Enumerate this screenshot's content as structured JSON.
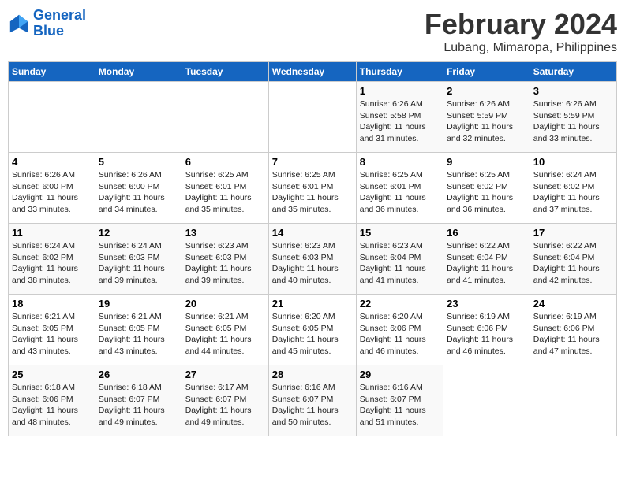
{
  "logo": {
    "line1": "General",
    "line2": "Blue"
  },
  "title": "February 2024",
  "subtitle": "Lubang, Mimaropa, Philippines",
  "days_of_week": [
    "Sunday",
    "Monday",
    "Tuesday",
    "Wednesday",
    "Thursday",
    "Friday",
    "Saturday"
  ],
  "weeks": [
    [
      {
        "day": "",
        "info": ""
      },
      {
        "day": "",
        "info": ""
      },
      {
        "day": "",
        "info": ""
      },
      {
        "day": "",
        "info": ""
      },
      {
        "day": "1",
        "sunrise": "6:26 AM",
        "sunset": "5:58 PM",
        "daylight": "11 hours and 31 minutes."
      },
      {
        "day": "2",
        "sunrise": "6:26 AM",
        "sunset": "5:59 PM",
        "daylight": "11 hours and 32 minutes."
      },
      {
        "day": "3",
        "sunrise": "6:26 AM",
        "sunset": "5:59 PM",
        "daylight": "11 hours and 33 minutes."
      }
    ],
    [
      {
        "day": "4",
        "sunrise": "6:26 AM",
        "sunset": "6:00 PM",
        "daylight": "11 hours and 33 minutes."
      },
      {
        "day": "5",
        "sunrise": "6:26 AM",
        "sunset": "6:00 PM",
        "daylight": "11 hours and 34 minutes."
      },
      {
        "day": "6",
        "sunrise": "6:25 AM",
        "sunset": "6:01 PM",
        "daylight": "11 hours and 35 minutes."
      },
      {
        "day": "7",
        "sunrise": "6:25 AM",
        "sunset": "6:01 PM",
        "daylight": "11 hours and 35 minutes."
      },
      {
        "day": "8",
        "sunrise": "6:25 AM",
        "sunset": "6:01 PM",
        "daylight": "11 hours and 36 minutes."
      },
      {
        "day": "9",
        "sunrise": "6:25 AM",
        "sunset": "6:02 PM",
        "daylight": "11 hours and 36 minutes."
      },
      {
        "day": "10",
        "sunrise": "6:24 AM",
        "sunset": "6:02 PM",
        "daylight": "11 hours and 37 minutes."
      }
    ],
    [
      {
        "day": "11",
        "sunrise": "6:24 AM",
        "sunset": "6:02 PM",
        "daylight": "11 hours and 38 minutes."
      },
      {
        "day": "12",
        "sunrise": "6:24 AM",
        "sunset": "6:03 PM",
        "daylight": "11 hours and 39 minutes."
      },
      {
        "day": "13",
        "sunrise": "6:23 AM",
        "sunset": "6:03 PM",
        "daylight": "11 hours and 39 minutes."
      },
      {
        "day": "14",
        "sunrise": "6:23 AM",
        "sunset": "6:03 PM",
        "daylight": "11 hours and 40 minutes."
      },
      {
        "day": "15",
        "sunrise": "6:23 AM",
        "sunset": "6:04 PM",
        "daylight": "11 hours and 41 minutes."
      },
      {
        "day": "16",
        "sunrise": "6:22 AM",
        "sunset": "6:04 PM",
        "daylight": "11 hours and 41 minutes."
      },
      {
        "day": "17",
        "sunrise": "6:22 AM",
        "sunset": "6:04 PM",
        "daylight": "11 hours and 42 minutes."
      }
    ],
    [
      {
        "day": "18",
        "sunrise": "6:21 AM",
        "sunset": "6:05 PM",
        "daylight": "11 hours and 43 minutes."
      },
      {
        "day": "19",
        "sunrise": "6:21 AM",
        "sunset": "6:05 PM",
        "daylight": "11 hours and 43 minutes."
      },
      {
        "day": "20",
        "sunrise": "6:21 AM",
        "sunset": "6:05 PM",
        "daylight": "11 hours and 44 minutes."
      },
      {
        "day": "21",
        "sunrise": "6:20 AM",
        "sunset": "6:05 PM",
        "daylight": "11 hours and 45 minutes."
      },
      {
        "day": "22",
        "sunrise": "6:20 AM",
        "sunset": "6:06 PM",
        "daylight": "11 hours and 46 minutes."
      },
      {
        "day": "23",
        "sunrise": "6:19 AM",
        "sunset": "6:06 PM",
        "daylight": "11 hours and 46 minutes."
      },
      {
        "day": "24",
        "sunrise": "6:19 AM",
        "sunset": "6:06 PM",
        "daylight": "11 hours and 47 minutes."
      }
    ],
    [
      {
        "day": "25",
        "sunrise": "6:18 AM",
        "sunset": "6:06 PM",
        "daylight": "11 hours and 48 minutes."
      },
      {
        "day": "26",
        "sunrise": "6:18 AM",
        "sunset": "6:07 PM",
        "daylight": "11 hours and 49 minutes."
      },
      {
        "day": "27",
        "sunrise": "6:17 AM",
        "sunset": "6:07 PM",
        "daylight": "11 hours and 49 minutes."
      },
      {
        "day": "28",
        "sunrise": "6:16 AM",
        "sunset": "6:07 PM",
        "daylight": "11 hours and 50 minutes."
      },
      {
        "day": "29",
        "sunrise": "6:16 AM",
        "sunset": "6:07 PM",
        "daylight": "11 hours and 51 minutes."
      },
      {
        "day": "",
        "info": ""
      },
      {
        "day": "",
        "info": ""
      }
    ]
  ]
}
